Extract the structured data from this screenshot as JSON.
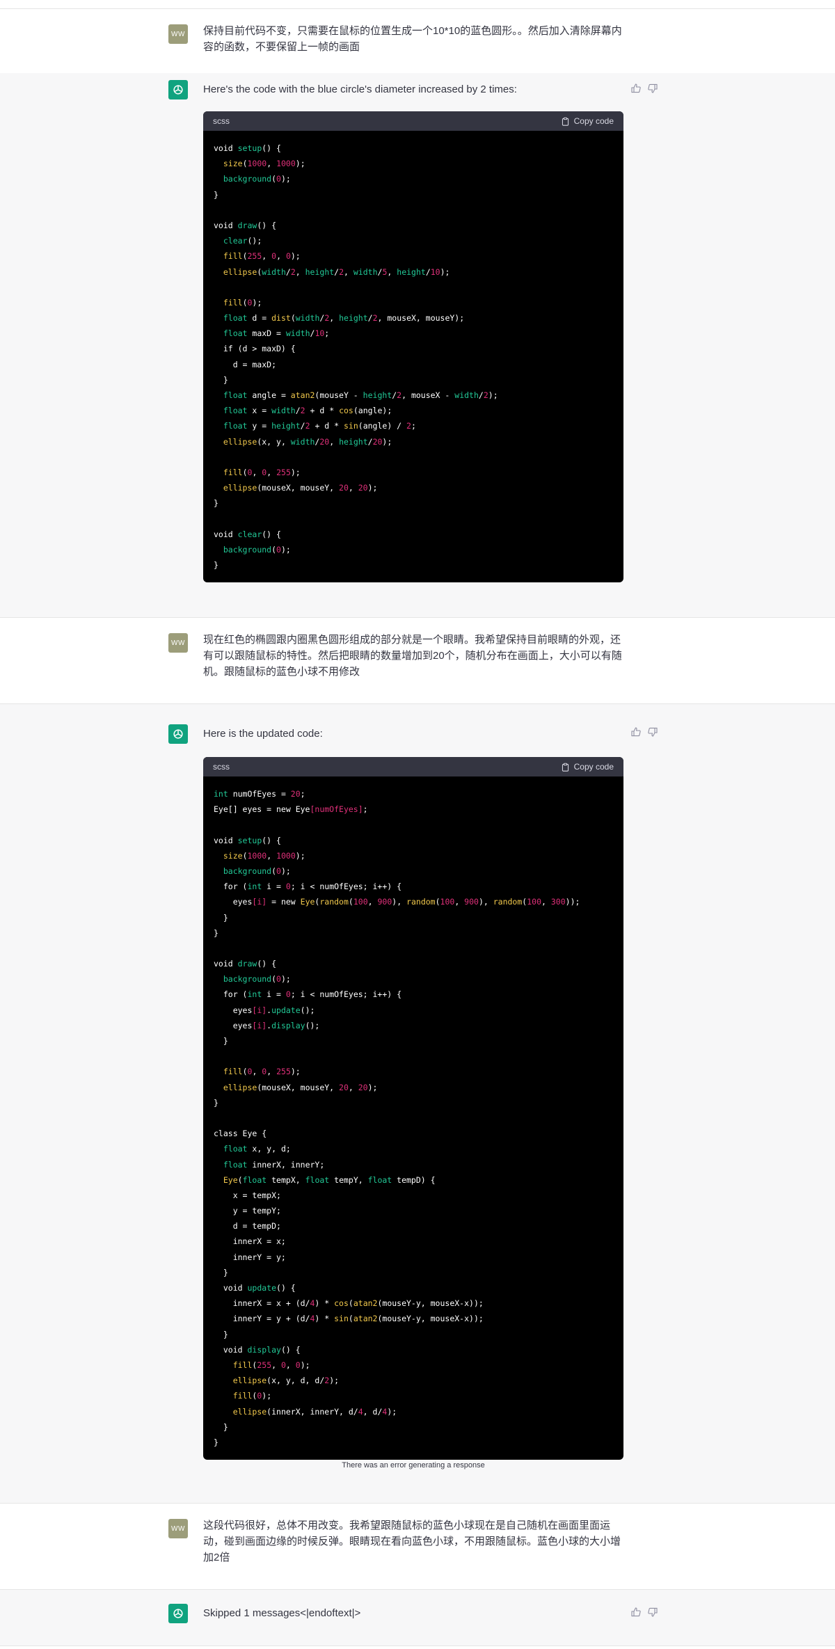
{
  "messages": [
    {
      "role": "user",
      "avatar": "WW",
      "text": "保持目前代码不变，只需要在鼠标的位置生成一个10*10的蓝色圆形。。然后加入清除屏幕内容的函数，不要保留上一帧的画面"
    },
    {
      "role": "assistant",
      "text": "Here's the code with the blue circle's diameter increased by 2 times:",
      "code_lang": "scss",
      "copy_label": "Copy code",
      "code": [
        "void setup() {",
        "  size(1000, 1000);",
        "  background(0);",
        "}",
        "",
        "void draw() {",
        "  clear();",
        "  fill(255, 0, 0);",
        "  ellipse(width/2, height/2, width/5, height/10);",
        "",
        "  fill(0);",
        "  float d = dist(width/2, height/2, mouseX, mouseY);",
        "  float maxD = width/10;",
        "  if (d > maxD) {",
        "    d = maxD;",
        "  }",
        "  float angle = atan2(mouseY - height/2, mouseX - width/2);",
        "  float x = width/2 + d * cos(angle);",
        "  float y = height/2 + d * sin(angle) / 2;",
        "  ellipse(x, y, width/20, height/20);",
        "",
        "  fill(0, 0, 255);",
        "  ellipse(mouseX, mouseY, 20, 20);",
        "}",
        "",
        "void clear() {",
        "  background(0);",
        "}"
      ]
    },
    {
      "role": "user",
      "avatar": "WW",
      "text": "现在红色的椭圆跟内圈黑色圆形组成的部分就是一个眼睛。我希望保持目前眼睛的外观，还有可以跟随鼠标的特性。然后把眼睛的数量增加到20个，随机分布在画面上，大小可以有随机。跟随鼠标的蓝色小球不用修改"
    },
    {
      "role": "assistant",
      "text": "Here is the updated code:",
      "code_lang": "scss",
      "copy_label": "Copy code",
      "code": [
        "int numOfEyes = 20;",
        "Eye[] eyes = new Eye[numOfEyes];",
        "",
        "void setup() {",
        "  size(1000, 1000);",
        "  background(0);",
        "  for (int i = 0; i < numOfEyes; i++) {",
        "    eyes[i] = new Eye(random(100, 900), random(100, 900), random(100, 300));",
        "  }",
        "}",
        "",
        "void draw() {",
        "  background(0);",
        "  for (int i = 0; i < numOfEyes; i++) {",
        "    eyes[i].update();",
        "    eyes[i].display();",
        "  }",
        "",
        "  fill(0, 0, 255);",
        "  ellipse(mouseX, mouseY, 20, 20);",
        "}",
        "",
        "class Eye {",
        "  float x, y, d;",
        "  float innerX, innerY;",
        "  Eye(float tempX, float tempY, float tempD) {",
        "    x = tempX;",
        "    y = tempY;",
        "    d = tempD;",
        "    innerX = x;",
        "    innerY = y;",
        "  }",
        "  void update() {",
        "    innerX = x + (d/4) * cos(atan2(mouseY-y, mouseX-x));",
        "    innerY = y + (d/4) * sin(atan2(mouseY-y, mouseX-x));",
        "  }",
        "  void display() {",
        "    fill(255, 0, 0);",
        "    ellipse(x, y, d, d/2);",
        "    fill(0);",
        "    ellipse(innerX, innerY, d/4, d/4);",
        "  }",
        "}"
      ],
      "error": "There was an error generating a response"
    },
    {
      "role": "user",
      "avatar": "WW",
      "text": "这段代码很好，总体不用改变。我希望跟随鼠标的蓝色小球现在是自己随机在画面里面运动，碰到画面边缘的时候反弹。眼睛现在看向蓝色小球，不用跟随鼠标。蓝色小球的大小增加2倍"
    },
    {
      "role": "assistant",
      "text": "Skipped 1 messages<|endoftext|>"
    }
  ],
  "colors": {
    "user_bg": "#ffffff",
    "assistant_bg": "#f7f7f8",
    "code_bg": "#000000",
    "code_header_bg": "#343541",
    "ai_avatar": "#10a37f",
    "user_avatar": "#9c9d7a"
  }
}
